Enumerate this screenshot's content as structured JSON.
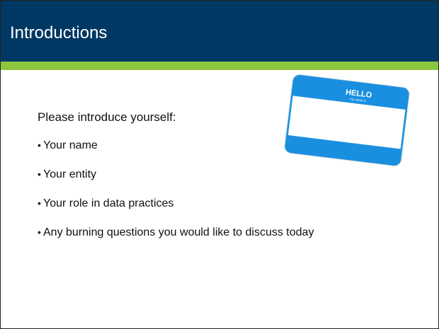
{
  "slide": {
    "title": "Introductions",
    "colors": {
      "title_bar": "#003864",
      "accent": "#8cc63f",
      "tag_blue": "#1a8fe0"
    },
    "intro": "Please introduce yourself:",
    "bullets": [
      "Your name",
      "Your entity",
      "Your role in data practices",
      "Any burning questions you would like to discuss today"
    ],
    "name_tag": {
      "heading": "HELLO",
      "subheading": "my name is",
      "icon": "hello-name-tag-icon"
    }
  }
}
